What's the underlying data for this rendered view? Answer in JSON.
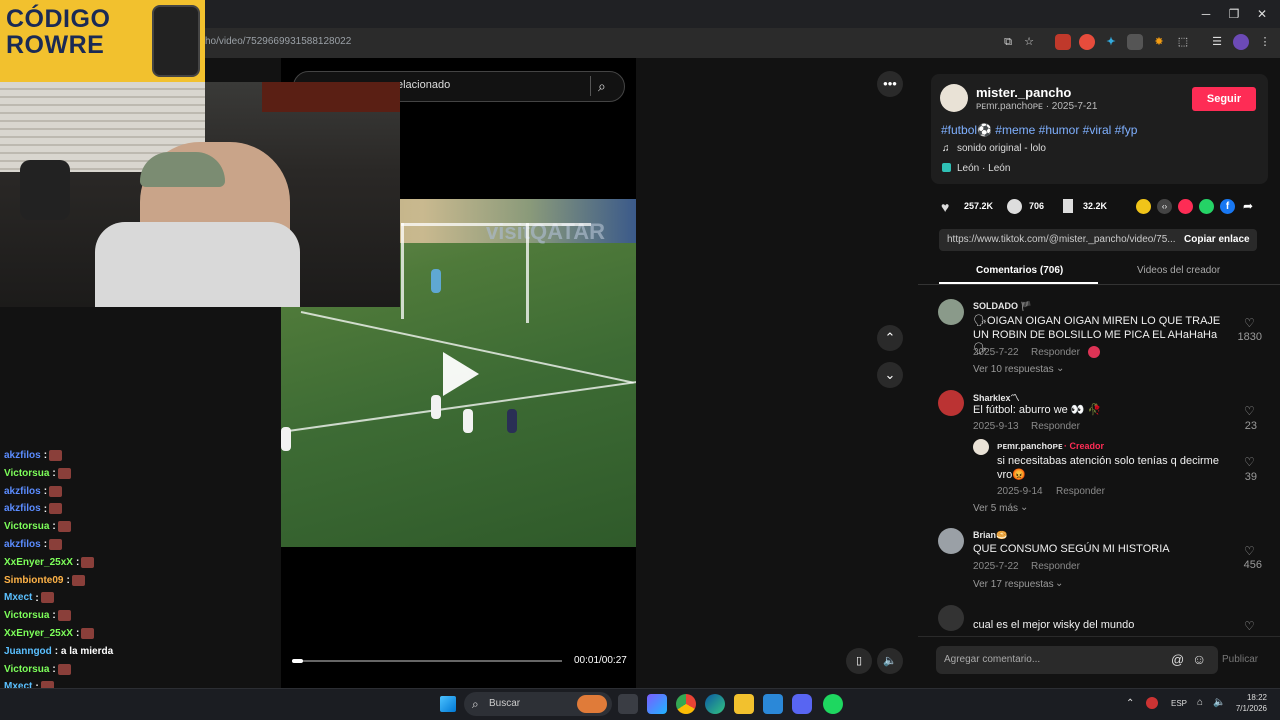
{
  "browser": {
    "url": "cho/video/7529669931588128022",
    "window_minimize": "─",
    "window_maximize": "❐",
    "window_close": "✕"
  },
  "overlay": {
    "logo_line1": "CÓDIGO",
    "logo_line2": "ROWRE"
  },
  "video": {
    "search_text": "elacionado",
    "time": "00:01/00:27",
    "progress": 0.04
  },
  "chat": [
    {
      "user": "akzfilos",
      "color": "#5b8cff",
      "text": ":"
    },
    {
      "user": "Victorsua",
      "color": "#7dff5a",
      "text": ":"
    },
    {
      "user": "akzfilos",
      "color": "#5b8cff",
      "text": ":"
    },
    {
      "user": "akzfilos",
      "color": "#5b8cff",
      "text": ":"
    },
    {
      "user": "Victorsua",
      "color": "#7dff5a",
      "text": ":"
    },
    {
      "user": "akzfilos",
      "color": "#5b8cff",
      "text": ":"
    },
    {
      "user": "XxEnyer_25xX",
      "color": "#7dff5a",
      "text": ":"
    },
    {
      "user": "Simbionte09",
      "color": "#ffb347",
      "text": ":"
    },
    {
      "user": "Mxect",
      "color": "#5bc0ff",
      "text": ":"
    },
    {
      "user": "Victorsua",
      "color": "#7dff5a",
      "text": ":"
    },
    {
      "user": "XxEnyer_25xX",
      "color": "#7dff5a",
      "text": ":"
    },
    {
      "user": "Juanngod",
      "color": "#5bc0ff",
      "text": ": a la mierda"
    },
    {
      "user": "Victorsua",
      "color": "#7dff5a",
      "text": ":"
    },
    {
      "user": "Mxect",
      "color": "#5bc0ff",
      "text": ":"
    },
    {
      "user": "Victorsua",
      "color": "#7dff5a",
      "text": ":"
    }
  ],
  "post": {
    "username": "mister._pancho",
    "handle_date": "ᴘᴇmr.panchoᴘᴇ · 2025-7-21",
    "follow_label": "Seguir",
    "hashtags": "#futbol⚽ #meme #humor #viral #fyp",
    "music": "sonido original - lolo",
    "location": "León · León",
    "likes": "257.2K",
    "comments": "706",
    "saves": "32.2K",
    "link": "https://www.tiktok.com/@mister._pancho/video/75...",
    "copy_link_label": "Copiar enlace"
  },
  "tabs": {
    "comments": "Comentarios (706)",
    "creator_videos": "Videos del creador"
  },
  "comments": [
    {
      "name": "SOLDADO 🏴",
      "text": "🗣OIGAN OIGAN OIGAN MIREN LO QUE TRAJE UN ROBIN DE BOLSILLO ME PICA EL AHaHaHa🗣",
      "date": "2025-7-22",
      "reply": "Responder",
      "likes": "1830",
      "more": "Ver 10 respuestas"
    },
    {
      "name": "Sharklex〽",
      "text": "El fútbol: aburro we 👀 🥀",
      "date": "2025-9-13",
      "reply": "Responder",
      "likes": "23",
      "more": "Ver 5 más"
    },
    {
      "name": "Brian🥯",
      "text": "QUE CONSUMO SEGÚN MI HISTORIA",
      "date": "2025-7-22",
      "reply": "Responder",
      "likes": "456",
      "more": "Ver 17 respuestas"
    },
    {
      "name": "",
      "text": "cual es el mejor wisky del mundo",
      "date": "",
      "reply": "",
      "likes": "",
      "more": ""
    }
  ],
  "reply": {
    "name": "ᴘᴇmr.panchoᴘᴇ",
    "creator_tag": "· Creador",
    "text": "si necesitabas atención solo tenías q decirme vro😡",
    "date": "2025-9-14",
    "reply": "Responder",
    "likes": "39"
  },
  "comment_input": {
    "placeholder": "Agregar comentario...",
    "publish_label": "Publicar"
  },
  "taskbar": {
    "search_label": "Buscar",
    "language": "ESP",
    "time": "18:22",
    "date": "7/1/2026"
  }
}
